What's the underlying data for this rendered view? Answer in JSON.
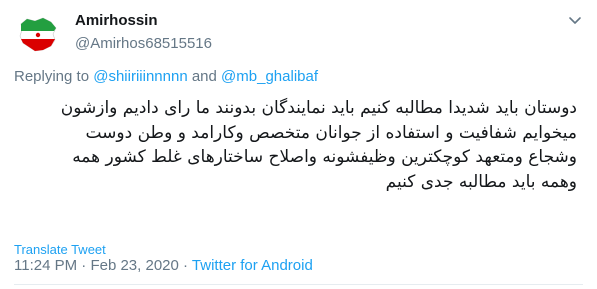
{
  "user": {
    "display_name": "Amirhossin",
    "handle": "@Amirhos68515516",
    "avatar_icon": "iran-flag-map-avatar"
  },
  "reply": {
    "prefix": "Replying to",
    "mention_1": "@shiiriiinnnnn",
    "conjunction": "and",
    "mention_2": "@mb_ghalibaf"
  },
  "tweet": {
    "lines": [
      "دوستان باید شدیدا مطالبه کنیم باید نمایندگان بدونند ما رای دادیم وازشون",
      "میخوایم شفافیت و استفاده از جوانان متخصص وکارامد و وطن دوست",
      "وشجاع ومتعهد کوچکترین وظیفشونه واصلاح ساختارهای غلط کشور همه",
      "وهمه باید مطالبه جدی کنیم"
    ]
  },
  "translate_label": "Translate Tweet",
  "meta": {
    "time": "11:24 PM",
    "separator": "·",
    "date": "Feb 23, 2020",
    "source": "Twitter for Android"
  },
  "colors": {
    "link": "#1da1f2",
    "secondary_text": "#657786",
    "primary_text": "#14171a"
  }
}
